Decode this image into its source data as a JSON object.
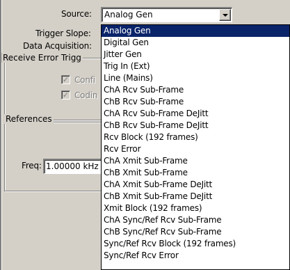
{
  "source": {
    "label": "Source:",
    "value": "Analog Gen",
    "options": [
      "Analog Gen",
      "Digital Gen",
      "Jitter Gen",
      "Trig In (Ext)",
      "Line (Mains)",
      "ChA Rcv Sub-Frame",
      "ChB Rcv Sub-Frame",
      "ChA Rcv Sub-Frame DeJitt",
      "ChB Rcv Sub-Frame DeJitt",
      "Rcv Block (192 frames)",
      "Rcv Error",
      "ChA Xmit Sub-Frame",
      "ChB Xmit Sub-Frame",
      "ChA Xmit Sub-Frame DeJitt",
      "ChB Xmit Sub-Frame DeJitt",
      "Xmit Block (192 frames)",
      "ChA Sync/Ref Rcv Sub-Frame",
      "ChB Sync/Ref Rcv Sub-Frame",
      "Sync/Ref Rcv Block (192 frames)",
      "Sync/Ref Rcv Error"
    ]
  },
  "trigger_slope": {
    "label": "Trigger Slope:"
  },
  "data_acquisition": {
    "label": "Data Acquisition:"
  },
  "receive_error": {
    "title": "Receive Error Trigg",
    "checkbox1_label": "Confi",
    "checkbox2_label": "Codin"
  },
  "references": {
    "title": "References",
    "freq_label": "Freq:",
    "freq_value": "1.00000 kHz"
  }
}
